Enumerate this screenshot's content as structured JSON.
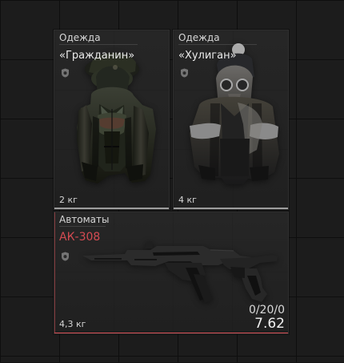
{
  "items": [
    {
      "category": "Одежда",
      "name": "«Гражданин»",
      "weight": "2 кг",
      "icon": "shield-icon",
      "preview": "civilian-outfit"
    },
    {
      "category": "Одежда",
      "name": "«Хулиган»",
      "weight": "4 кг",
      "icon": "shield-icon",
      "preview": "gas-mask-outfit"
    },
    {
      "category": "Автоматы",
      "name": "АК-308",
      "weight": "4,3 кг",
      "ammo": "0/20/0",
      "caliber": "7.62",
      "icon": "shield-icon",
      "preview": "assault-rifle"
    }
  ],
  "colors": {
    "accent_red": "#d44b52",
    "panel_bg": "#242424",
    "grid": "#121212",
    "highlight": "#bdbdbd"
  }
}
